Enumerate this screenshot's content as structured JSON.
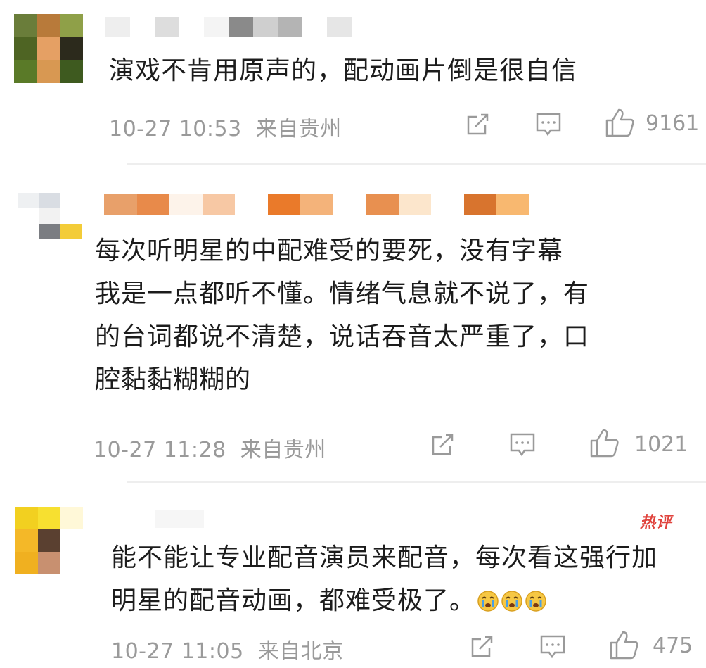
{
  "comments": [
    {
      "text": "演戏不肯用原声的，配动画片倒是很自信",
      "time": "10-27 10:53",
      "location": "来自贵州",
      "likes": "9161",
      "avatar_colors": [
        "#6a7d3a",
        "#b87a3a",
        "#8fa048",
        "#4e6423",
        "#e5a064",
        "#2c2a1c",
        "#5a7a28",
        "#d89852",
        "#3e5a1f"
      ],
      "namebar_colors": [
        "#eeeeee",
        "#ffffff",
        "#dddddd",
        "#ffffff",
        "#f4f4f4",
        "#8a8a8a",
        "#cfcfcf",
        "#b4b4b4",
        "#ffffff",
        "#e6e6e6"
      ]
    },
    {
      "text": "每次听明星的中配难受的要死，没有字幕\n我是一点都听不懂。情绪气息就不说了，有\n的台词都说不清楚，说话吞音太严重了，口\n腔黏黏糊糊的",
      "time": "10-27 11:28",
      "location": "来自贵州",
      "likes": "1021",
      "avatar_colors": [
        "#eef0f2",
        "#d9dde3",
        "#ffffff",
        "#ffffff",
        "#f2f2f2",
        "#ffffff",
        "#ffffff",
        "#7b7d82",
        "#f3cc38"
      ],
      "namebar_colors": [
        "#e8a06a",
        "#e88a4a",
        "#fdf3ea",
        "#f7c8a4",
        "#ffffff",
        "#ea7a2a",
        "#f4b37a",
        "#ffffff",
        "#e89050",
        "#fce6cc",
        "#ffffff",
        "#d8742e",
        "#f8b870"
      ]
    },
    {
      "text": "能不能让专业配音演员来配音，每次看这强行加\n明星的配音动画，都难受极了。",
      "time": "10-27 11:05",
      "location": "来自北京",
      "likes": "475",
      "hot_label": "热评",
      "avatar_colors": [
        "#f2d020",
        "#f7e030",
        "#fff8d8",
        "#f4b828",
        "#5a4030",
        "#ffffff",
        "#f0b020",
        "#c89070",
        "#ffffff"
      ],
      "namebar_colors": [
        "#ffffff",
        "#f6f6f6",
        "#ffffff"
      ]
    }
  ],
  "icons": {
    "share": "share-icon",
    "comment": "comment-icon",
    "like": "like-icon",
    "emoji": "crying-face-emoji"
  }
}
